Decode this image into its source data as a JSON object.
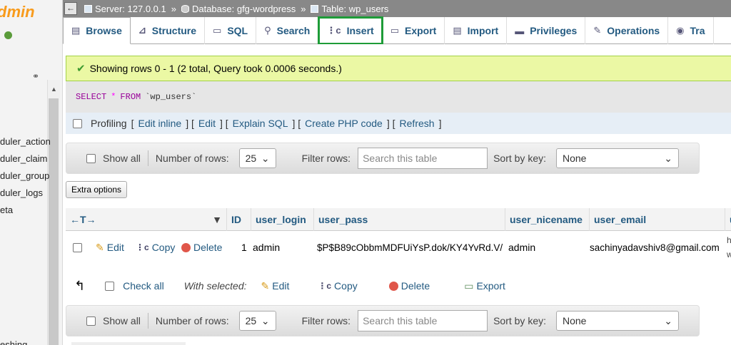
{
  "app": {
    "logo_text": "dmin"
  },
  "breadcrumb": {
    "collapse": "←",
    "server": "Server: 127.0.0.1",
    "database": "Database: gfg-wordpress",
    "table": "Table: wp_users",
    "separator": "»"
  },
  "tabs": [
    {
      "label": "Browse",
      "icon": "browse-icon",
      "active": true
    },
    {
      "label": "Structure",
      "icon": "structure-icon"
    },
    {
      "label": "SQL",
      "icon": "sql-icon"
    },
    {
      "label": "Search",
      "icon": "search-icon"
    },
    {
      "label": "Insert",
      "icon": "insert-icon",
      "highlighted": true
    },
    {
      "label": "Export",
      "icon": "export-icon"
    },
    {
      "label": "Import",
      "icon": "import-icon"
    },
    {
      "label": "Privileges",
      "icon": "privileges-icon"
    },
    {
      "label": "Operations",
      "icon": "operations-icon"
    },
    {
      "label": "Tra",
      "icon": "tracking-icon"
    }
  ],
  "sidebar": {
    "items": [
      "duler_action",
      "duler_claim",
      "duler_group",
      "duler_logs",
      "eta",
      "eshing"
    ]
  },
  "message": {
    "text": "Showing rows 0 - 1 (2 total, Query took 0.0006 seconds.)"
  },
  "query": {
    "select": "SELECT",
    "star": "*",
    "from": "FROM",
    "table": "`wp_users`"
  },
  "profiling": {
    "label": "Profiling",
    "links": [
      "Edit inline",
      "Edit",
      "Explain SQL",
      "Create PHP code",
      "Refresh"
    ]
  },
  "nav": {
    "show_all": "Show all",
    "rows_label": "Number of rows:",
    "rows_value": "25",
    "filter_label": "Filter rows:",
    "filter_placeholder": "Search this table",
    "sort_label": "Sort by key:",
    "sort_value": "None"
  },
  "extra_options": "Extra options",
  "table": {
    "columns": [
      "ID",
      "user_login",
      "user_pass",
      "user_nicename",
      "user_email",
      "u"
    ],
    "arrows": "←T→",
    "row": {
      "edit": "Edit",
      "copy": "Copy",
      "delete": "Delete",
      "id": "1",
      "user_login": "admin",
      "user_pass": "$P$B89cObbmMDFUiYsP.dok/KY4YvRd.V/",
      "user_nicename": "admin",
      "user_email": "sachinyadavshiv8@gmail.com",
      "user_url": "ht",
      "user_url2": "w"
    }
  },
  "bulk": {
    "check_all": "Check all",
    "with_selected": "With selected:",
    "edit": "Edit",
    "copy": "Copy",
    "delete": "Delete",
    "export": "Export"
  },
  "colors": {
    "accent": "#235a81",
    "highlight": "#1e9c38",
    "success_bg": "#ebf8a4"
  }
}
